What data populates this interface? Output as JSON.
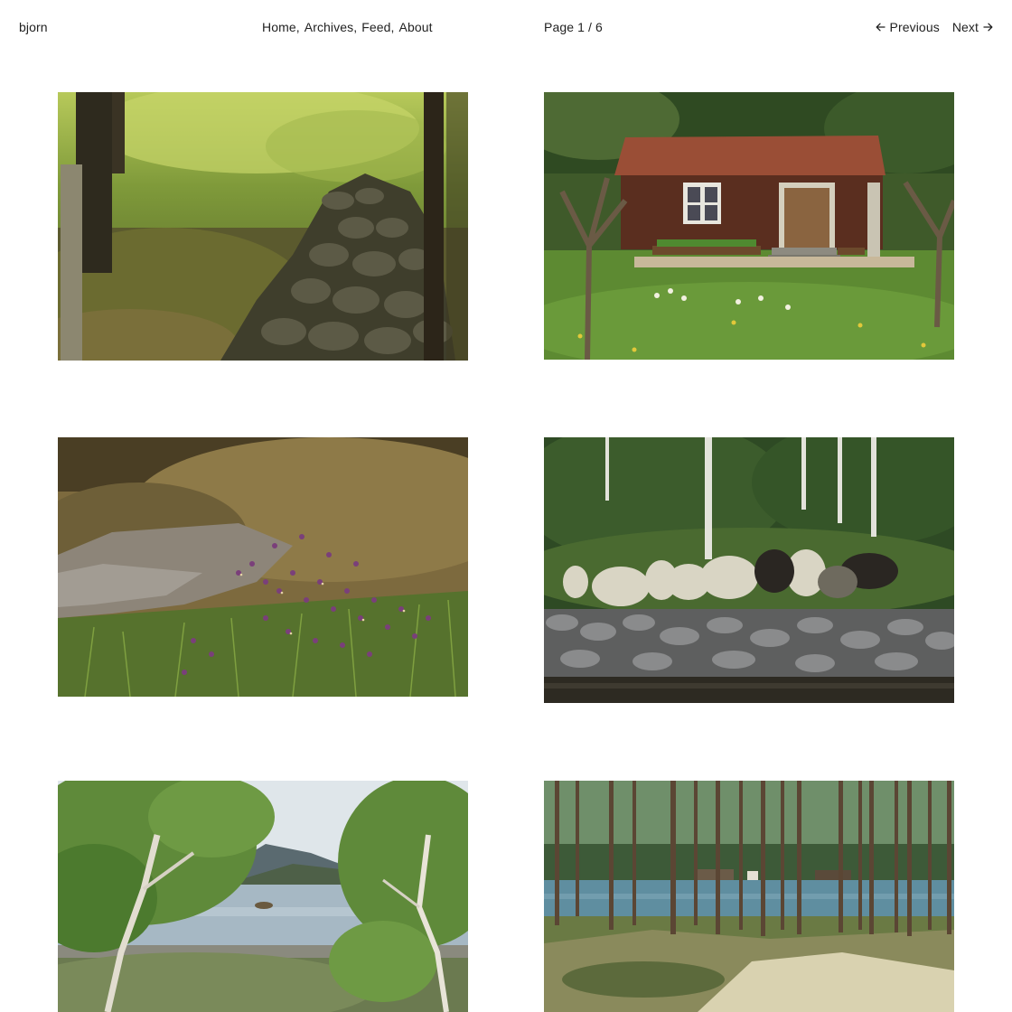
{
  "site": {
    "title": "bjorn"
  },
  "nav": {
    "items": [
      {
        "label": "Home"
      },
      {
        "label": "Archives"
      },
      {
        "label": "Feed"
      },
      {
        "label": "About"
      }
    ],
    "separator": ","
  },
  "pagination": {
    "status": "Page 1 / 6",
    "previous_label": "Previous",
    "next_label": "Next"
  },
  "photos": [
    {
      "subject": "forest-stone-wall"
    },
    {
      "subject": "red-wooden-cottage"
    },
    {
      "subject": "wild-violets-on-rock"
    },
    {
      "subject": "sheep-by-water"
    },
    {
      "subject": "lake-with-birch-trees"
    },
    {
      "subject": "pine-forest-shoreline"
    }
  ]
}
